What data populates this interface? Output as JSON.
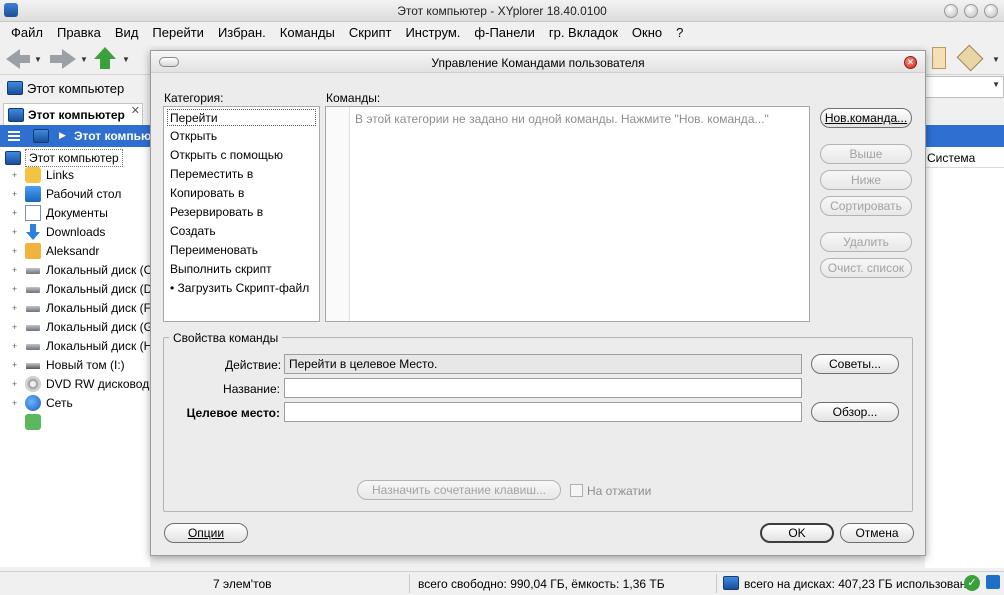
{
  "window": {
    "title": "Этот компьютер - XYplorer 18.40.0100"
  },
  "menu": [
    "Файл",
    "Правка",
    "Вид",
    "Перейти",
    "Избран.",
    "Команды",
    "Скрипт",
    "Инструм.",
    "ф-Панели",
    "гр. Вкладок",
    "Окно",
    "?"
  ],
  "left_panel": {
    "address": "Этот компьютер",
    "tab_label": "Этот компьютер",
    "crumb_label": "Этот компьют",
    "tree_root": "Этот компьютер",
    "tree_items": [
      {
        "label": "Links",
        "icon": "links-folder-icon"
      },
      {
        "label": "Рабочий стол",
        "icon": "desktop-icon"
      },
      {
        "label": "Документы",
        "icon": "documents-icon"
      },
      {
        "label": "Downloads",
        "icon": "downloads-icon"
      },
      {
        "label": "Aleksandr",
        "icon": "user-folder-icon"
      },
      {
        "label": "Локальный диск (C",
        "icon": "hard-disk-icon"
      },
      {
        "label": "Локальный диск (D",
        "icon": "hard-disk-icon"
      },
      {
        "label": "Локальный диск (F",
        "icon": "hard-disk-icon"
      },
      {
        "label": "Локальный диск (G",
        "icon": "hard-disk-icon"
      },
      {
        "label": "Локальный диск (H",
        "icon": "hard-disk-icon"
      },
      {
        "label": "Новый том (I:)",
        "icon": "drive-icon"
      },
      {
        "label": "DVD RW дисковод (",
        "icon": "dvd-drive-icon"
      },
      {
        "label": "Сеть",
        "icon": "network-icon"
      },
      {
        "label": "",
        "icon": "recycle-bin-icon"
      }
    ]
  },
  "right_panel": {
    "column_header": "Система"
  },
  "status": {
    "items_count": "7 элем'тов",
    "free_space": "всего свободно: 990,04 ГБ, ёмкость: 1,36 ТБ",
    "disks_total": "всего на дисках: 407,23 ГБ использован"
  },
  "dialog": {
    "title": "Управление Командами пользователя",
    "category_label": "Категория:",
    "commands_label": "Команды:",
    "categories": [
      "Перейти",
      "Открыть",
      "Открыть с помощью",
      "Переместить в",
      "Копировать в",
      "Резервировать в",
      "Создать",
      "Переименовать",
      "Выполнить скрипт",
      "• Загрузить Скрипт-файл"
    ],
    "commands_placeholder": "В этой категории не задано ни одной команды. Нажмите \"Нов. команда...\"",
    "buttons": {
      "new_command": "Нов.команда...",
      "up": "Выше",
      "down": "Ниже",
      "sort": "Сортировать",
      "delete": "Удалить",
      "clear_list": "Очист. список",
      "tips": "Советы...",
      "browse": "Обзор...",
      "assign_shortcut": "Назначить сочетание клавиш...",
      "options": "Опции",
      "ok": "OK",
      "cancel": "Отмена"
    },
    "properties": {
      "group_title": "Свойства команды",
      "action_label": "Действие:",
      "action_value": "Перейти в целевое Место.",
      "name_label": "Название:",
      "name_value": "",
      "target_label": "Целевое место:",
      "target_value": "",
      "on_release_label": "На отжатии"
    }
  }
}
